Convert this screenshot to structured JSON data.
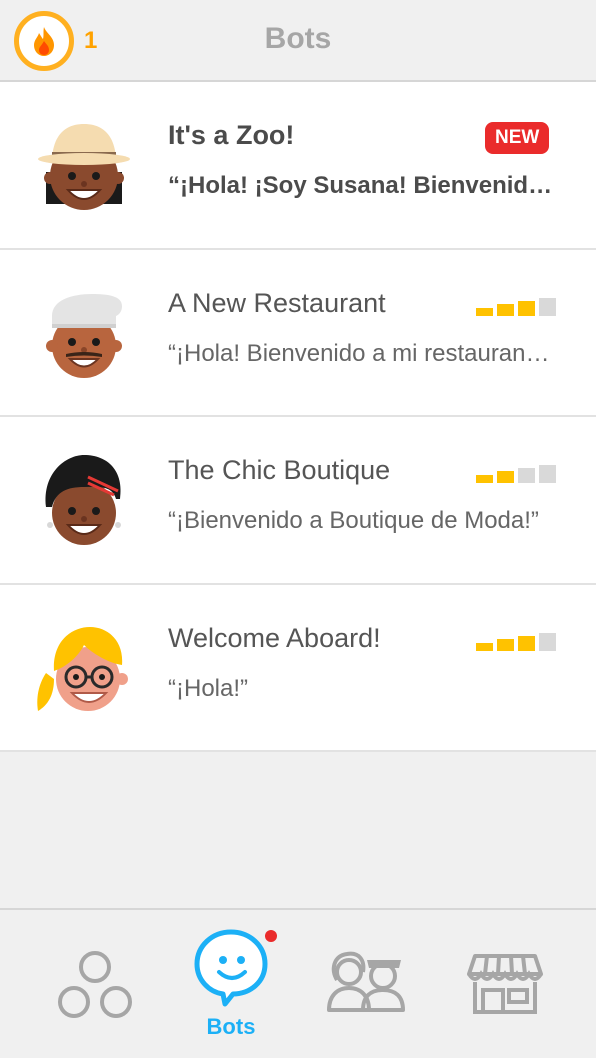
{
  "header": {
    "title": "Bots",
    "streak_count": "1"
  },
  "bots": [
    {
      "name": "It's a Zoo!",
      "message": "“¡Hola! ¡Soy Susana! Bienvenido al zoo!”",
      "badge": "NEW",
      "level": null
    },
    {
      "name": "A New Restaurant",
      "message": "“¡Hola! Bienvenido a mi restaurante.”",
      "badge": null,
      "level": 3
    },
    {
      "name": "The Chic Boutique",
      "message": "“¡Bienvenido a Boutique de Moda!”",
      "badge": null,
      "level": 2
    },
    {
      "name": "Welcome Aboard!",
      "message": "“¡Hola!”",
      "badge": null,
      "level": 3
    }
  ],
  "level_max": 4,
  "tabbar": {
    "active_tab": "bots",
    "bots_label": "Bots"
  },
  "colors": {
    "accent": "#1cb0f6",
    "streak": "#ffa200",
    "badge": "#ea2b2b",
    "level_on": "#ffc200",
    "level_off": "#d9d9d9"
  }
}
